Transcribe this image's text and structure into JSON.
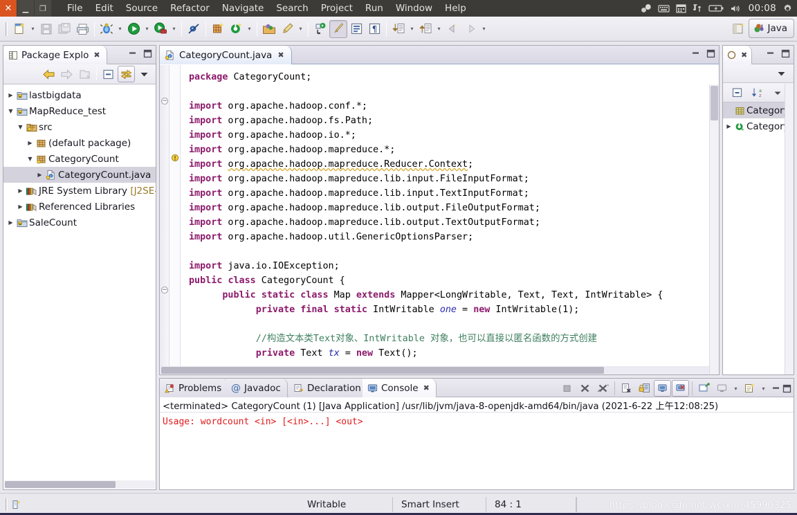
{
  "window": {
    "controls": {
      "close": "✕",
      "minimize": "▁",
      "maximize": "❐"
    },
    "menus": [
      "File",
      "Edit",
      "Source",
      "Refactor",
      "Navigate",
      "Search",
      "Project",
      "Run",
      "Window",
      "Help"
    ],
    "tray": {
      "icons": [
        "weather-icon",
        "keyboard-icon",
        "calendar-icon",
        "network-icon",
        "battery-icon",
        "volume-icon"
      ],
      "clock": "00:08",
      "settings_icon": "gear-icon"
    }
  },
  "toolbar": {
    "perspective_label": "Java",
    "buttons": [
      "new-wizard",
      "save",
      "save-all",
      "print",
      "debug",
      "run",
      "run-external-tools",
      "toggle-mark-occurrences",
      "new-java-project",
      "new-java-class",
      "open-type",
      "search",
      "next-annotation",
      "previous-annotation",
      "last-edit-location",
      "back",
      "forward"
    ]
  },
  "package_explorer": {
    "tab_label": "Package Explo",
    "tab_icon": "package-explorer-icon",
    "close_icon": "close-icon",
    "toolbar_buttons": [
      "back",
      "forward",
      "up",
      "collapse-all",
      "link-with-editor",
      "view-menu"
    ],
    "tree": [
      {
        "label": "lastbigdata",
        "icon": "java-project-icon",
        "twist": "▶",
        "indent": 0,
        "selected": false
      },
      {
        "label": "MapReduce_test",
        "icon": "java-project-icon",
        "twist": "▼",
        "indent": 0,
        "selected": false
      },
      {
        "label": "src",
        "icon": "source-folder-icon",
        "twist": "▼",
        "indent": 1,
        "selected": false
      },
      {
        "label": "(default package)",
        "icon": "package-icon",
        "twist": "▶",
        "indent": 2,
        "selected": false
      },
      {
        "label": "CategoryCount",
        "icon": "package-icon",
        "twist": "▼",
        "indent": 2,
        "selected": false
      },
      {
        "label": "CategoryCount.java",
        "icon": "java-file-icon",
        "twist": "▶",
        "indent": 3,
        "selected": true
      },
      {
        "label": "JRE System Library ",
        "suffix": "[J2SE-",
        "icon": "library-icon",
        "twist": "▶",
        "indent": 1,
        "selected": false
      },
      {
        "label": "Referenced Libraries",
        "icon": "library-icon",
        "twist": "▶",
        "indent": 1,
        "selected": false
      },
      {
        "label": "SaleCount",
        "icon": "java-project-icon",
        "twist": "▶",
        "indent": 0,
        "selected": false
      }
    ]
  },
  "editor": {
    "tab_label": "CategoryCount.java",
    "tab_icon": "java-file-icon",
    "close_icon": "close-icon",
    "code_lines": [
      {
        "text": "package CategoryCount;",
        "type": "pkg"
      },
      {
        "text": "",
        "type": "blank"
      },
      {
        "text": "import org.apache.hadoop.conf.*;",
        "type": "import",
        "fold": true
      },
      {
        "text": "import org.apache.hadoop.fs.Path;",
        "type": "import"
      },
      {
        "text": "import org.apache.hadoop.io.*;",
        "type": "import"
      },
      {
        "text": "import org.apache.hadoop.mapreduce.*;",
        "type": "import"
      },
      {
        "text": "import org.apache.hadoop.mapreduce.Reducer.Context;",
        "type": "import",
        "warning": true
      },
      {
        "text": "import org.apache.hadoop.mapreduce.lib.input.FileInputFormat;",
        "type": "import"
      },
      {
        "text": "import org.apache.hadoop.mapreduce.lib.input.TextInputFormat;",
        "type": "import"
      },
      {
        "text": "import org.apache.hadoop.mapreduce.lib.output.FileOutputFormat;",
        "type": "import"
      },
      {
        "text": "import org.apache.hadoop.mapreduce.lib.output.TextOutputFormat;",
        "type": "import"
      },
      {
        "text": "import org.apache.hadoop.util.GenericOptionsParser;",
        "type": "import"
      },
      {
        "text": "",
        "type": "blank"
      },
      {
        "text": "import java.io.IOException;",
        "type": "import"
      },
      {
        "text": "public class CategoryCount {",
        "type": "class"
      },
      {
        "text": "public static class Map extends Mapper<LongWritable, Text, Text, IntWritable> {",
        "type": "inner",
        "fold": true
      },
      {
        "text": "private final static IntWritable one = new IntWritable(1);",
        "type": "field"
      },
      {
        "text": "",
        "type": "blank"
      },
      {
        "text": "//构造文本类Text对象、IntWritable 对象，也可以直接以匿名函数的方式创建",
        "type": "comment"
      },
      {
        "text": "private Text tx = new Text();",
        "type": "field2"
      }
    ]
  },
  "outline": {
    "tab_icon": "outline-icon",
    "close_icon": "close-icon",
    "view_menu_icon": "view-menu-icon",
    "toolbar_buttons": [
      "collapse-all",
      "sort",
      "view-menu"
    ],
    "items": [
      {
        "label": "Category",
        "icon": "package-icon",
        "twist": "",
        "selected": true
      },
      {
        "label": "Category",
        "icon": "class-icon",
        "twist": "▶",
        "selected": false
      }
    ]
  },
  "console": {
    "tabs": [
      {
        "label": "Problems",
        "icon": "problems-icon",
        "active": false
      },
      {
        "label": "Javadoc",
        "icon": "javadoc-icon",
        "active": false
      },
      {
        "label": "Declaration",
        "icon": "declaration-icon",
        "active": false
      },
      {
        "label": "Console",
        "icon": "console-icon",
        "active": true,
        "close_icon": "close-icon"
      }
    ],
    "toolbar_buttons": [
      "terminate",
      "remove-launch",
      "remove-all-terminated",
      "clear-console",
      "scroll-lock",
      "pin-console",
      "display-selected-console",
      "open-console",
      "new-console-view",
      "console-menu"
    ],
    "header": "<terminated> CategoryCount (1) [Java Application] /usr/lib/jvm/java-8-openjdk-amd64/bin/java (2021-6-22 上午12:08:25)",
    "output_lines": [
      "Usage: wordcount <in> [<in>...] <out>"
    ],
    "output_color": "#e01b1b"
  },
  "statusbar": {
    "icon": "writable-indicator-icon",
    "writable": "Writable",
    "insert_mode": "Smart Insert",
    "position": "84 : 1",
    "watermark": "https://blog.csdn.net/weixin_45990325"
  }
}
